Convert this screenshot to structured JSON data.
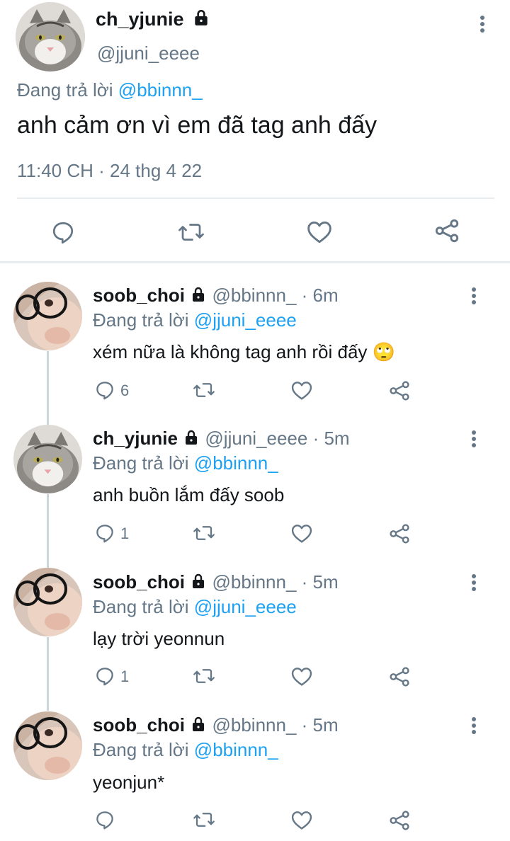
{
  "colors": {
    "text": "#14171a",
    "muted": "#657786",
    "link": "#1da1f2",
    "divider": "#e6ecf0"
  },
  "main_tweet": {
    "display_name": "ch_yjunie",
    "handle": "@jjuni_eeee",
    "replying_prefix": "Đang trả lời",
    "replying_to": "@bbinnn_",
    "text": "anh cảm ơn vì em đã tag anh đấy",
    "timestamp": "11:40 CH · 24 thg 4 22",
    "icons": [
      "reply-icon",
      "retweet-icon",
      "like-icon",
      "share-icon"
    ]
  },
  "replies": [
    {
      "display_name": "soob_choi",
      "handle": "@bbinnn_",
      "time": "· 6m",
      "replying_prefix": "Đang trả lời",
      "replying_to": "@jjuni_eeee",
      "text": "xém nữa là không tag anh rồi đấy",
      "emoji": "🙄",
      "reply_count": "6"
    },
    {
      "display_name": "ch_yjunie",
      "handle": "@jjuni_eeee",
      "time": "· 5m",
      "replying_prefix": "Đang trả lời",
      "replying_to": "@bbinnn_",
      "text": "anh buồn lắm đấy soob",
      "emoji": "",
      "reply_count": "1"
    },
    {
      "display_name": "soob_choi",
      "handle": "@bbinnn_",
      "time": "· 5m",
      "replying_prefix": "Đang trả lời",
      "replying_to": "@jjuni_eeee",
      "text": "lạy trời yeonnun",
      "emoji": "",
      "reply_count": "1"
    },
    {
      "display_name": "soob_choi",
      "handle": "@bbinnn_",
      "time": "· 5m",
      "replying_prefix": "Đang trả lời",
      "replying_to": "@bbinnn_",
      "text": "yeonjun*",
      "emoji": "",
      "reply_count": ""
    }
  ]
}
